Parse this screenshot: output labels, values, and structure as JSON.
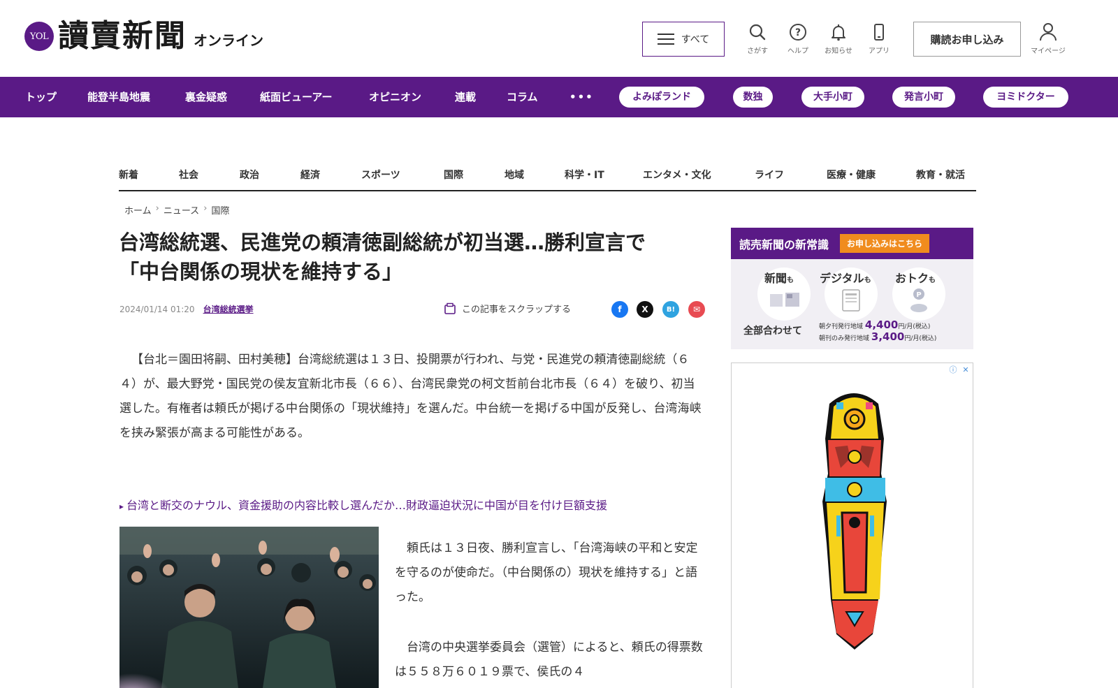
{
  "header": {
    "logo_badge": "YOL",
    "logo_main": "讀賣新聞",
    "logo_sub": "オンライン",
    "all_button": "すべて",
    "utils": [
      {
        "label": "さがす",
        "icon": "search-icon"
      },
      {
        "label": "ヘルプ",
        "icon": "help-icon"
      },
      {
        "label": "お知らせ",
        "icon": "bell-icon"
      },
      {
        "label": "アプリ",
        "icon": "phone-icon"
      }
    ],
    "subscribe_button": "購読お申し込み",
    "mypage_label": "マイページ"
  },
  "main_nav": {
    "items": [
      "トップ",
      "能登半島地震",
      "裏金疑惑",
      "紙面ビューアー",
      "オピニオン",
      "連載",
      "コラム",
      "•••"
    ],
    "pills": [
      "よみぽランド",
      "数独",
      "大手小町",
      "発言小町",
      "ヨミドクター"
    ]
  },
  "section_nav": [
    "新着",
    "社会",
    "政治",
    "経済",
    "スポーツ",
    "国際",
    "地域",
    "科学・IT",
    "エンタメ・文化",
    "ライフ",
    "医療・健康",
    "教育・就活"
  ],
  "breadcrumb": [
    "ホーム",
    "ニュース",
    "国際"
  ],
  "article": {
    "title_line1": "台湾総統選、民進党の頼清徳副総統が初当選…勝利宣言で",
    "title_line2": "「中台関係の現状を維持する」",
    "date": "2024/01/14 01:20",
    "tag": "台湾総統選挙",
    "scrap": "この記事をスクラップする",
    "lead": "【台北＝園田将嗣、田村美穂】台湾総統選は１３日、投開票が行われ、与党・民進党の頼清徳副総統（６４）が、最大野党・国民党の侯友宜新北市長（６６）、台湾民衆党の柯文哲前台北市長（６４）を破り、初当選した。有権者は頼氏が掲げる中台関係の「現状維持」を選んだ。中台統一を掲げる中国が反発し、台湾海峡を挟み緊張が高まる可能性がある。",
    "related_link": "台湾と断交のナウル、資金援助の内容比較し選んだか…財政逼迫状況に中国が目を付け巨額支援",
    "para2": "頼氏は１３日夜、勝利宣言し、「台湾海峡の平和と安定を守るのが使命だ。（中台関係の）現状を維持する」と語った。",
    "para3": "台湾の中央選挙委員会（選管）によると、頼氏の得票数は５５８万６０１９票で、侯氏の４"
  },
  "share": [
    {
      "name": "facebook",
      "label": "f",
      "color": "#1877f2"
    },
    {
      "name": "x",
      "label": "X",
      "color": "#111111"
    },
    {
      "name": "hatena",
      "label": "B!",
      "color": "#2fa3e0"
    },
    {
      "name": "mail",
      "label": "✉",
      "color": "#e84b52"
    }
  ],
  "promo": {
    "head": "読売新聞の新常識",
    "cta": "お申し込みはこちら",
    "items": [
      {
        "main": "新聞",
        "suffix": "も"
      },
      {
        "main": "デジタル",
        "suffix": "も"
      },
      {
        "main": "おトク",
        "suffix": "も"
      }
    ],
    "all_label": "全部合わせて",
    "prices": [
      {
        "area": "朝夕刊発行地域",
        "amount": "4,400",
        "unit": "円/月",
        "tax": "(税込)"
      },
      {
        "area": "朝刊のみ発行地域",
        "amount": "3,400",
        "unit": "円/月",
        "tax": "(税込)"
      }
    ]
  },
  "colors": {
    "brand_purple": "#5a1a86",
    "promo_orange": "#f08c1e"
  }
}
